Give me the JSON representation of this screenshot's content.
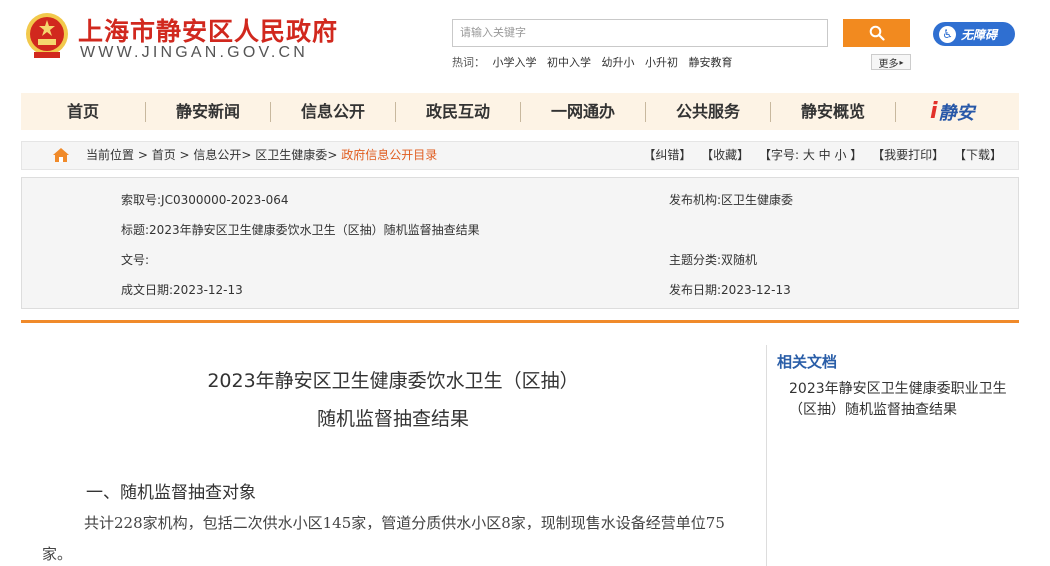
{
  "header": {
    "site_title": "上海市静安区人民政府",
    "site_url": "WWW.JINGAN.GOV.CN",
    "search_placeholder": "请输入关键字",
    "accessibility_label": "无障碍",
    "hot_label": "热词：",
    "hot_words": [
      "小学入学",
      "初中入学",
      "幼升小",
      "小升初",
      "静安教育"
    ],
    "more_label": "更多"
  },
  "nav": {
    "items": [
      "首页",
      "静安新闻",
      "信息公开",
      "政民互动",
      "一网通办",
      "公共服务",
      "静安概览"
    ],
    "logo_text": "静安"
  },
  "breadcrumb": {
    "prefix": "当前位置",
    "path": [
      "首页",
      "信息公开",
      "区卫生健康委"
    ],
    "current": "政府信息公开目录",
    "tools": [
      "【纠错】",
      "【收藏】",
      "【字号: 大 中 小 】",
      "【我要打印】",
      "【下载】"
    ]
  },
  "meta": {
    "index_no": "索取号:JC0300000-2023-064",
    "publisher": "发布机构:区卫生健康委",
    "title": "标题:2023年静安区卫生健康委饮水卫生（区抽）随机监督抽查结果",
    "doc_no": "文号:",
    "category": "主题分类:双随机",
    "created": "成文日期:2023-12-13",
    "published": "发布日期:2023-12-13"
  },
  "article": {
    "title_line1": "2023年静安区卫生健康委饮水卫生（区抽）",
    "title_line2": "随机监督抽查结果",
    "section1": "一、随机监督抽查对象",
    "paragraph1": "共计228家机构，包括二次供水小区145家，管道分质供水小区8家，现制现售水设备经营单位75家。"
  },
  "sidebar": {
    "title": "相关文档",
    "links": [
      "2023年静安区卫生健康委职业卫生（区抽）随机监督抽查结果"
    ]
  },
  "colors": {
    "brand_red": "#d1281e",
    "accent_orange": "#f28a1f",
    "link_blue": "#2a5ea8"
  }
}
